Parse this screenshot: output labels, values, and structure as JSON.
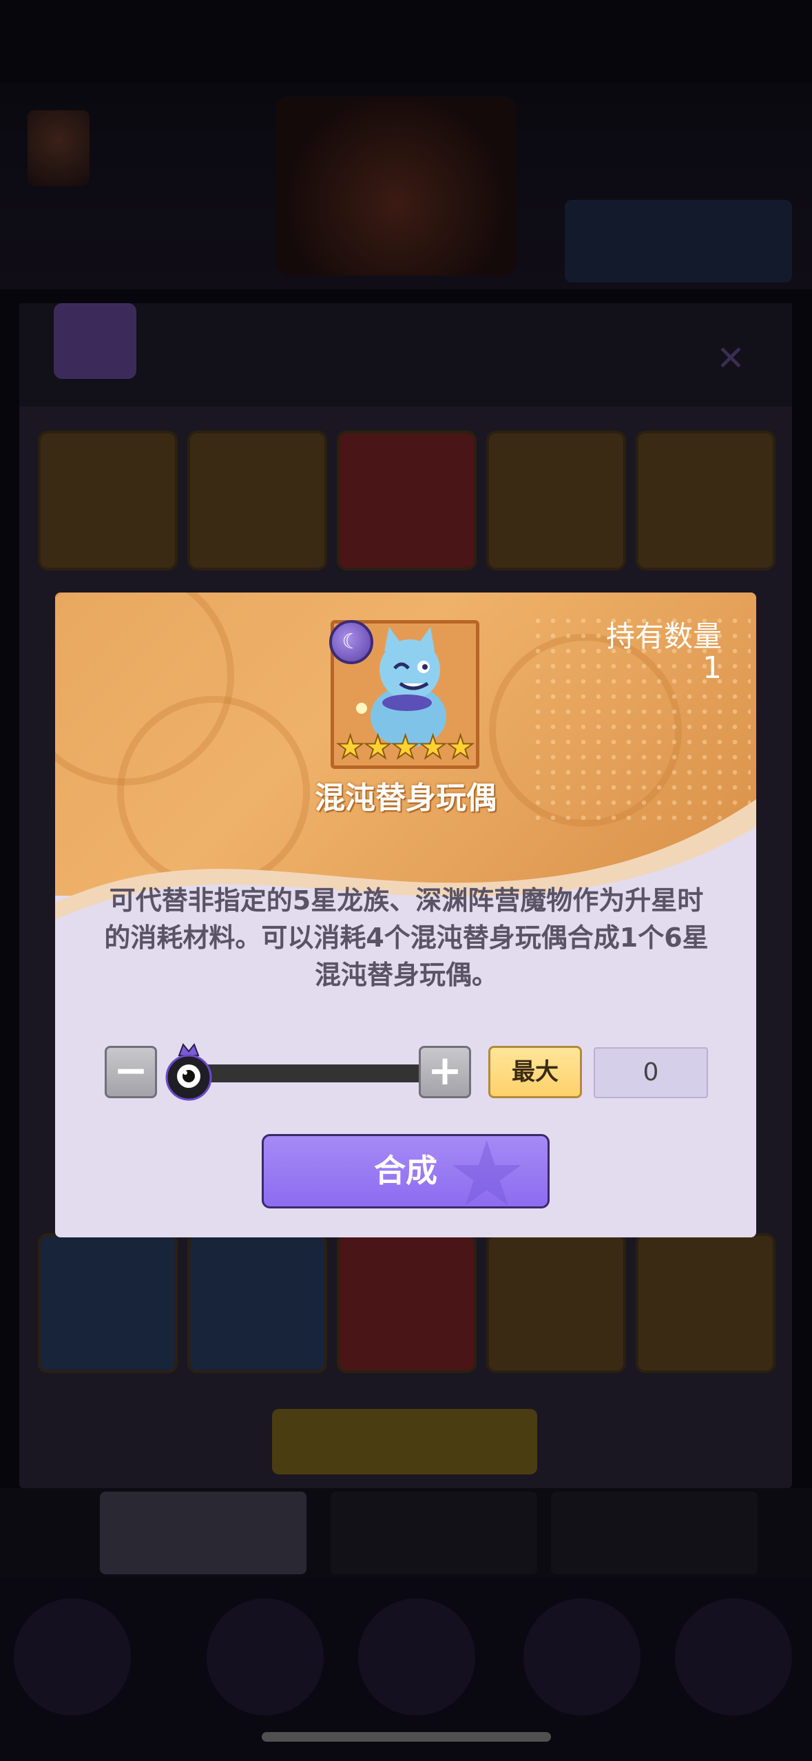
{
  "modal": {
    "item_name": "混沌替身玩偶",
    "owned_label": "持有数量",
    "owned_value": "1",
    "stars": 5,
    "description": "可代替非指定的5星龙族、深渊阵营魔物作为升星时的消耗材料。可以消耗4个混沌替身玩偶合成1个6星混沌替身玩偶。",
    "minus_label": "−",
    "plus_label": "+",
    "max_label": "最大",
    "quantity_value": "0",
    "slider_fraction": 0,
    "synthesize_label": "合成"
  },
  "icons": {
    "faction_badge": "dragon-faction-icon",
    "star": "star-icon",
    "slider_handle": "eye-handle-icon"
  },
  "colors": {
    "modal_top": "#efb26a",
    "modal_body": "#e3dcef",
    "synth_button": "#9b7cf2",
    "max_button": "#ffd97a",
    "star": "#ffd233"
  }
}
